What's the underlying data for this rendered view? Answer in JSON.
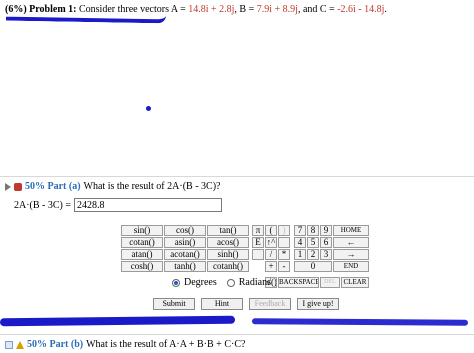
{
  "problem": {
    "prefix": "(6%)",
    "label": "Problem 1:",
    "text1": "Consider three vectors A = ",
    "a": "14.8i + 2.8j",
    "text2": ", B = ",
    "b": "7.9i + 8.9j",
    "text3": ", and C = ",
    "c": "-2.6i - 14.8j",
    "text4": "."
  },
  "part_a": {
    "percent": "50% Part (a)",
    "question": "What is the result of 2A·(B - 3C)?",
    "answer_label": "2A·(B - 3C) =",
    "answer_value": "2428.8"
  },
  "calculator": {
    "func_keys": [
      "sin()",
      "cos()",
      "tan()",
      "cotan()",
      "asin()",
      "acos()",
      "atan()",
      "acotan()",
      "sinh()",
      "cosh()",
      "tanh()",
      "cotanh()"
    ],
    "sym_keys": [
      "π",
      "(",
      ")",
      "E",
      "↑^",
      "/",
      "*",
      "+",
      "-",
      "√()",
      "BACKSPACE",
      "DEL",
      "CLEAR"
    ],
    "num_keys": [
      "7",
      "8",
      "9",
      "HOME",
      "4",
      "5",
      "6",
      "←",
      "1",
      "2",
      "3",
      "→",
      "0",
      "END"
    ],
    "degrees": "Degrees",
    "radians": "Radians"
  },
  "buttons": {
    "submit": "Submit",
    "hint": "Hint",
    "feedback": "Feedback",
    "give_up": "I give up!"
  },
  "part_b": {
    "percent": "50% Part (b)",
    "question": "What is the result of A·A + B·B + C·C?"
  }
}
